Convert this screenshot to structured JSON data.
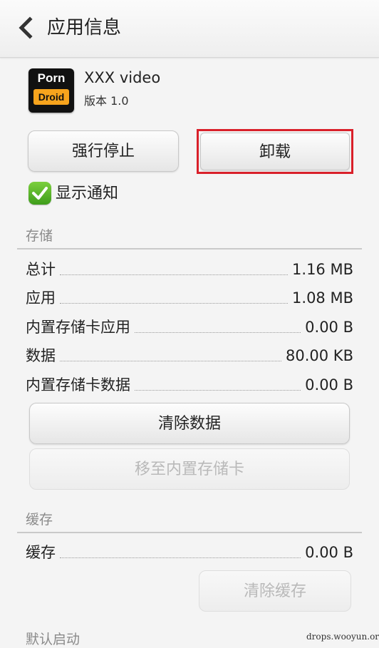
{
  "header": {
    "title": "应用信息"
  },
  "app": {
    "icon_line1": "Porn",
    "icon_line2": "Droid",
    "name": "XXX video",
    "version": "版本 1.0"
  },
  "actions": {
    "force_stop": "强行停止",
    "uninstall": "卸载"
  },
  "notification": {
    "label": "显示通知",
    "checked": true
  },
  "storage": {
    "section": "存储",
    "rows": [
      {
        "label": "总计",
        "value": "1.16 MB"
      },
      {
        "label": "应用",
        "value": "1.08 MB"
      },
      {
        "label": "内置存储卡应用",
        "value": "0.00 B"
      },
      {
        "label": "数据",
        "value": "80.00 KB"
      },
      {
        "label": "内置存储卡数据",
        "value": "0.00 B"
      }
    ],
    "clear_data": "清除数据",
    "move_to_card": "移至内置存储卡"
  },
  "cache": {
    "section": "缓存",
    "row": {
      "label": "缓存",
      "value": "0.00 B"
    },
    "clear_cache": "清除缓存"
  },
  "default_launch": {
    "section": "默认启动"
  },
  "watermark": "drops.wooyun.org",
  "colors": {
    "highlight": "#d9202a",
    "check": "#4caf1e"
  }
}
